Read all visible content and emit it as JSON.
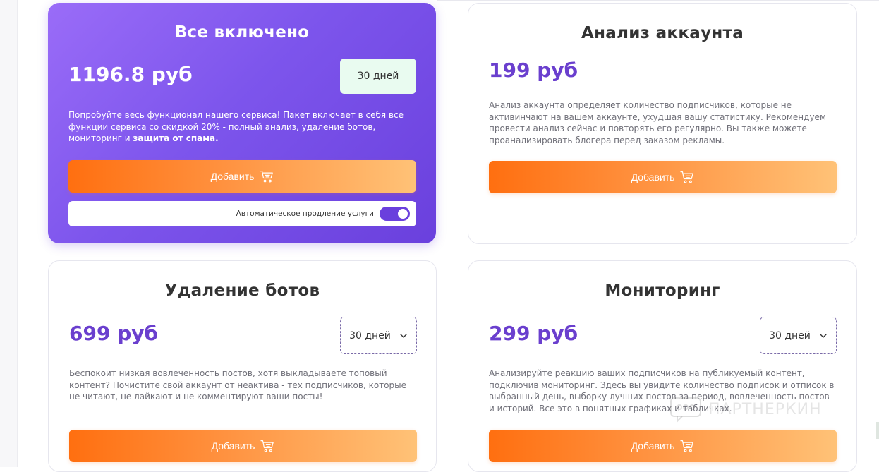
{
  "cards": {
    "all_inclusive": {
      "title": "Все включено",
      "price": "1196.8 руб",
      "period": "30 дней",
      "description": "Попробуйте весь функционал нашего сервиса! Пакет включает в себя все функции сервиса со скидкой 20% - полный анализ, удаление ботов, мониторинг и ",
      "description_bold": "защита от спама.",
      "add_label": "Добавить",
      "auto_renew_label": "Автоматическое продление услуги",
      "auto_renew_on": true
    },
    "account_analysis": {
      "title": "Анализ аккаунта",
      "price": "199 руб",
      "description": "Анализ аккаунта определяет количество подписчиков, которые не активинчают на вашем аккаунте, ухудшая вашу статистику. Рекомендуем провести анализ сейчас и повторять его регулярно. Вы также можете проанализировать блогера перед заказом рекламы.",
      "add_label": "Добавить"
    },
    "bot_removal": {
      "title": "Удаление ботов",
      "price": "699 руб",
      "period": "30 дней",
      "description": "Беспокоит низкая вовлеченность постов, хотя выкладываете топовый контент? Почистите свой аккаунт от неактива - тех подписчиков, которые не читают, не лайкают и не комментируют ваши посты!",
      "add_label": "Добавить"
    },
    "monitoring": {
      "title": "Мониторинг",
      "price": "299 руб",
      "period": "30 дней",
      "description": "Анализируйте реакцию ваших подписчиков на публикуемый контент, подключив мониторинг. Здесь вы увидите количество подписок и отписок в выбранный день, выборку лучших постов за период, вовлеченность постов и историй. Все это в понятных графиках и табличках.",
      "add_label": "Добавить"
    }
  },
  "watermark": {
    "text": "ПАРТНЕРКИН",
    "icon": "partnerkin-logo-icon"
  },
  "colors": {
    "accent_purple": "#6a3fce",
    "featured_gradient_start": "#9a6cf8",
    "featured_gradient_end": "#6a40dd",
    "button_gradient_start": "#ff6f10",
    "button_gradient_end": "#ffc277",
    "badge_bg": "#e9fbf0"
  }
}
